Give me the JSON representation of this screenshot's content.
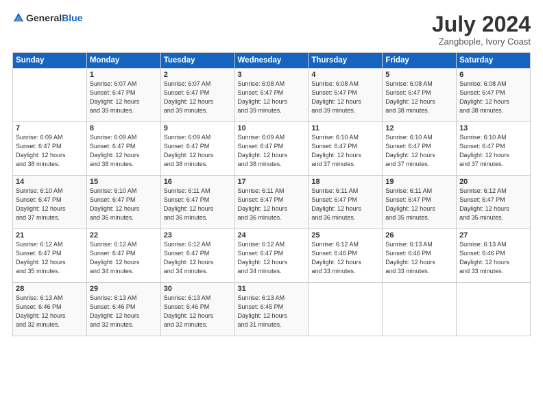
{
  "header": {
    "logo_general": "General",
    "logo_blue": "Blue",
    "title": "July 2024",
    "location": "Zangbople, Ivory Coast"
  },
  "days_of_week": [
    "Sunday",
    "Monday",
    "Tuesday",
    "Wednesday",
    "Thursday",
    "Friday",
    "Saturday"
  ],
  "weeks": [
    [
      {
        "day": "",
        "info": ""
      },
      {
        "day": "1",
        "info": "Sunrise: 6:07 AM\nSunset: 6:47 PM\nDaylight: 12 hours\nand 39 minutes."
      },
      {
        "day": "2",
        "info": "Sunrise: 6:07 AM\nSunset: 6:47 PM\nDaylight: 12 hours\nand 39 minutes."
      },
      {
        "day": "3",
        "info": "Sunrise: 6:08 AM\nSunset: 6:47 PM\nDaylight: 12 hours\nand 39 minutes."
      },
      {
        "day": "4",
        "info": "Sunrise: 6:08 AM\nSunset: 6:47 PM\nDaylight: 12 hours\nand 39 minutes."
      },
      {
        "day": "5",
        "info": "Sunrise: 6:08 AM\nSunset: 6:47 PM\nDaylight: 12 hours\nand 38 minutes."
      },
      {
        "day": "6",
        "info": "Sunrise: 6:08 AM\nSunset: 6:47 PM\nDaylight: 12 hours\nand 38 minutes."
      }
    ],
    [
      {
        "day": "7",
        "info": "Sunrise: 6:09 AM\nSunset: 6:47 PM\nDaylight: 12 hours\nand 38 minutes."
      },
      {
        "day": "8",
        "info": "Sunrise: 6:09 AM\nSunset: 6:47 PM\nDaylight: 12 hours\nand 38 minutes."
      },
      {
        "day": "9",
        "info": "Sunrise: 6:09 AM\nSunset: 6:47 PM\nDaylight: 12 hours\nand 38 minutes."
      },
      {
        "day": "10",
        "info": "Sunrise: 6:09 AM\nSunset: 6:47 PM\nDaylight: 12 hours\nand 38 minutes."
      },
      {
        "day": "11",
        "info": "Sunrise: 6:10 AM\nSunset: 6:47 PM\nDaylight: 12 hours\nand 37 minutes."
      },
      {
        "day": "12",
        "info": "Sunrise: 6:10 AM\nSunset: 6:47 PM\nDaylight: 12 hours\nand 37 minutes."
      },
      {
        "day": "13",
        "info": "Sunrise: 6:10 AM\nSunset: 6:47 PM\nDaylight: 12 hours\nand 37 minutes."
      }
    ],
    [
      {
        "day": "14",
        "info": "Sunrise: 6:10 AM\nSunset: 6:47 PM\nDaylight: 12 hours\nand 37 minutes."
      },
      {
        "day": "15",
        "info": "Sunrise: 6:10 AM\nSunset: 6:47 PM\nDaylight: 12 hours\nand 36 minutes."
      },
      {
        "day": "16",
        "info": "Sunrise: 6:11 AM\nSunset: 6:47 PM\nDaylight: 12 hours\nand 36 minutes."
      },
      {
        "day": "17",
        "info": "Sunrise: 6:11 AM\nSunset: 6:47 PM\nDaylight: 12 hours\nand 36 minutes."
      },
      {
        "day": "18",
        "info": "Sunrise: 6:11 AM\nSunset: 6:47 PM\nDaylight: 12 hours\nand 36 minutes."
      },
      {
        "day": "19",
        "info": "Sunrise: 6:11 AM\nSunset: 6:47 PM\nDaylight: 12 hours\nand 35 minutes."
      },
      {
        "day": "20",
        "info": "Sunrise: 6:12 AM\nSunset: 6:47 PM\nDaylight: 12 hours\nand 35 minutes."
      }
    ],
    [
      {
        "day": "21",
        "info": "Sunrise: 6:12 AM\nSunset: 6:47 PM\nDaylight: 12 hours\nand 35 minutes."
      },
      {
        "day": "22",
        "info": "Sunrise: 6:12 AM\nSunset: 6:47 PM\nDaylight: 12 hours\nand 34 minutes."
      },
      {
        "day": "23",
        "info": "Sunrise: 6:12 AM\nSunset: 6:47 PM\nDaylight: 12 hours\nand 34 minutes."
      },
      {
        "day": "24",
        "info": "Sunrise: 6:12 AM\nSunset: 6:47 PM\nDaylight: 12 hours\nand 34 minutes."
      },
      {
        "day": "25",
        "info": "Sunrise: 6:12 AM\nSunset: 6:46 PM\nDaylight: 12 hours\nand 33 minutes."
      },
      {
        "day": "26",
        "info": "Sunrise: 6:13 AM\nSunset: 6:46 PM\nDaylight: 12 hours\nand 33 minutes."
      },
      {
        "day": "27",
        "info": "Sunrise: 6:13 AM\nSunset: 6:46 PM\nDaylight: 12 hours\nand 33 minutes."
      }
    ],
    [
      {
        "day": "28",
        "info": "Sunrise: 6:13 AM\nSunset: 6:46 PM\nDaylight: 12 hours\nand 32 minutes."
      },
      {
        "day": "29",
        "info": "Sunrise: 6:13 AM\nSunset: 6:46 PM\nDaylight: 12 hours\nand 32 minutes."
      },
      {
        "day": "30",
        "info": "Sunrise: 6:13 AM\nSunset: 6:46 PM\nDaylight: 12 hours\nand 32 minutes."
      },
      {
        "day": "31",
        "info": "Sunrise: 6:13 AM\nSunset: 6:45 PM\nDaylight: 12 hours\nand 31 minutes."
      },
      {
        "day": "",
        "info": ""
      },
      {
        "day": "",
        "info": ""
      },
      {
        "day": "",
        "info": ""
      }
    ]
  ]
}
